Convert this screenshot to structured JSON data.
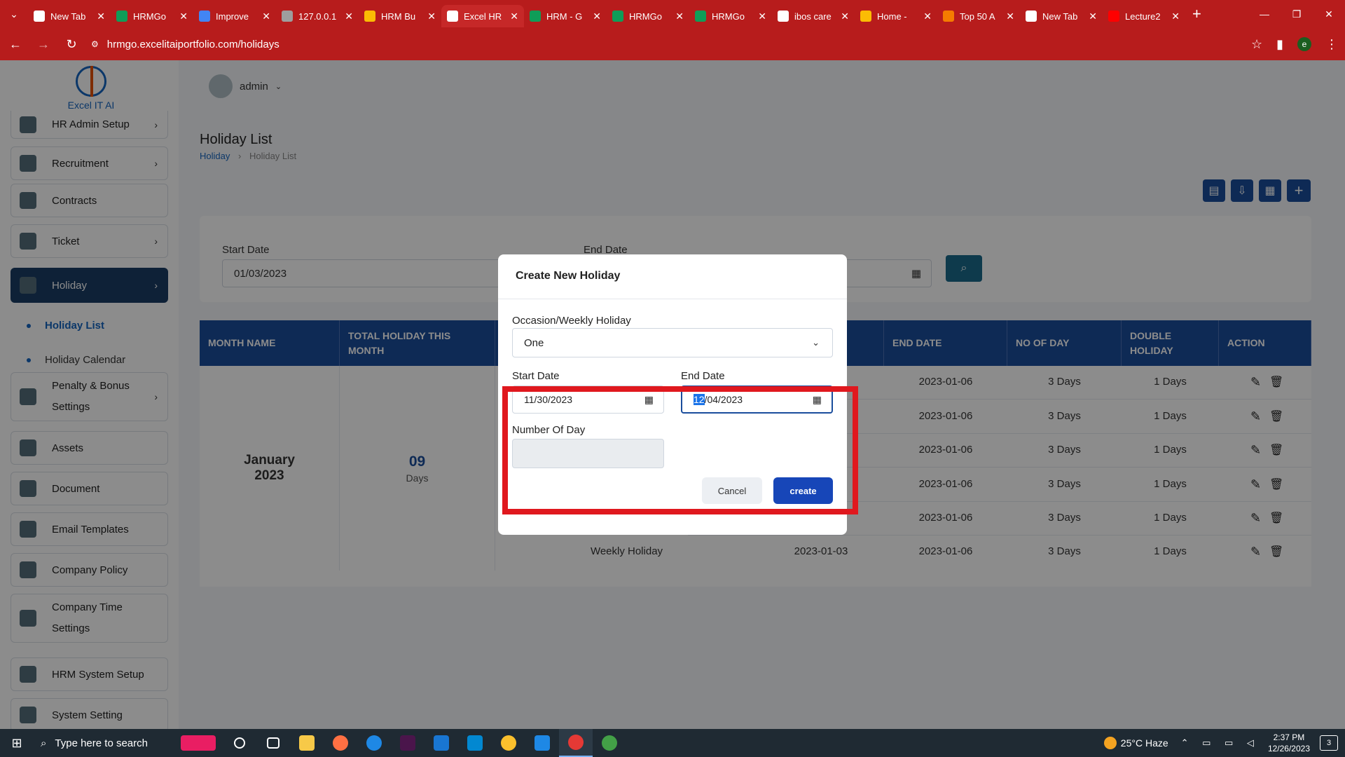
{
  "browser": {
    "tabs": [
      {
        "label": "New Tab",
        "icon": "chrome-icon",
        "color": "#ffffff"
      },
      {
        "label": "HRMGo",
        "icon": "sheets-icon",
        "color": "#0f9d58"
      },
      {
        "label": "Improve",
        "icon": "docs-icon",
        "color": "#4285f4"
      },
      {
        "label": "127.0.0.1",
        "icon": "globe-icon",
        "color": "#9e9e9e"
      },
      {
        "label": "HRM Bu",
        "icon": "drive-icon",
        "color": "#fbbc04"
      },
      {
        "label": "Excel HR",
        "icon": "site-icon",
        "color": "#ffffff"
      },
      {
        "label": "HRM - G",
        "icon": "sheets-icon",
        "color": "#0f9d58"
      },
      {
        "label": "HRMGo",
        "icon": "sheets-icon",
        "color": "#0f9d58"
      },
      {
        "label": "HRMGo",
        "icon": "sheets-icon",
        "color": "#0f9d58"
      },
      {
        "label": "ibos care",
        "icon": "google-icon",
        "color": "#ffffff"
      },
      {
        "label": "Home - ",
        "icon": "drive-icon",
        "color": "#fbbc04"
      },
      {
        "label": "Top 50 A",
        "icon": "bookmark-icon",
        "color": "#f57c00"
      },
      {
        "label": "New Tab",
        "icon": "chrome-icon",
        "color": "#ffffff"
      },
      {
        "label": "Lecture2",
        "icon": "youtube-icon",
        "color": "#ff0000"
      }
    ],
    "active_tab_index": 5,
    "url": "hrmgo.excelitaiportfolio.com/holidays",
    "profile_initial": "e"
  },
  "logo": {
    "text": "Excel IT AI"
  },
  "user": {
    "name": "admin"
  },
  "sidebar": {
    "items": [
      {
        "label": "HR Admin Setup",
        "chevron": true
      },
      {
        "label": "Recruitment",
        "chevron": true
      },
      {
        "label": "Contracts",
        "chevron": false
      },
      {
        "label": "Ticket",
        "chevron": true
      },
      {
        "label": "Holiday",
        "chevron": true,
        "active": true
      },
      {
        "label": "Penalty & Bonus Settings",
        "chevron": true
      },
      {
        "label": "Assets",
        "chevron": false
      },
      {
        "label": "Document",
        "chevron": false
      },
      {
        "label": "Email Templates",
        "chevron": false
      },
      {
        "label": "Company Policy",
        "chevron": false
      },
      {
        "label": "Company Time Settings",
        "chevron": false
      },
      {
        "label": "HRM System Setup",
        "chevron": false
      },
      {
        "label": "System Setting",
        "chevron": false
      }
    ],
    "sub_items": [
      {
        "label": "Holiday List",
        "active": true
      },
      {
        "label": "Holiday Calendar",
        "active": false
      }
    ]
  },
  "page": {
    "title": "Holiday List",
    "breadcrumb": [
      "Holiday",
      "Holiday List"
    ]
  },
  "filter": {
    "start_label": "Start Date",
    "start_value": "01/03/2023",
    "end_label": "End Date"
  },
  "table": {
    "headers": [
      "MONTH NAME",
      "TOTAL HOLIDAY THIS MONTH",
      "OCCASION",
      "START DATE",
      "END DATE",
      "NO OF DAY",
      "DOUBLE HOLIDAY",
      "ACTION"
    ],
    "month": "January 2023",
    "total": "09",
    "total_unit": "Days",
    "rows": [
      {
        "occasion": "",
        "start": "",
        "end": "2023-01-06",
        "days": "3 Days",
        "double": "1 Days"
      },
      {
        "occasion": "",
        "start": "",
        "end": "2023-01-06",
        "days": "3 Days",
        "double": "1 Days"
      },
      {
        "occasion": "",
        "start": "",
        "end": "2023-01-06",
        "days": "3 Days",
        "double": "1 Days"
      },
      {
        "occasion": "",
        "start": "",
        "end": "2023-01-06",
        "days": "3 Days",
        "double": "1 Days"
      },
      {
        "occasion": "",
        "start": "",
        "end": "2023-01-06",
        "days": "3 Days",
        "double": "1 Days"
      },
      {
        "occasion": "Weekly Holiday",
        "start": "2023-01-03",
        "end": "2023-01-06",
        "days": "3 Days",
        "double": "1 Days"
      }
    ]
  },
  "modal": {
    "title": "Create New Holiday",
    "occasion_label": "Occasion/Weekly Holiday",
    "occasion_value": "One",
    "start_label": "Start Date",
    "start_value": "11/30/2023",
    "end_label": "End Date",
    "end_value_selected": "12",
    "end_value_rest": "/04/2023",
    "days_label": "Number Of Day",
    "days_value": "",
    "cancel_label": "Cancel",
    "create_label": "create"
  },
  "taskbar": {
    "search_placeholder": "Type here to search",
    "weather": "25°C  Haze",
    "time": "2:37 PM",
    "date": "12/26/2023",
    "notifications": "3"
  }
}
